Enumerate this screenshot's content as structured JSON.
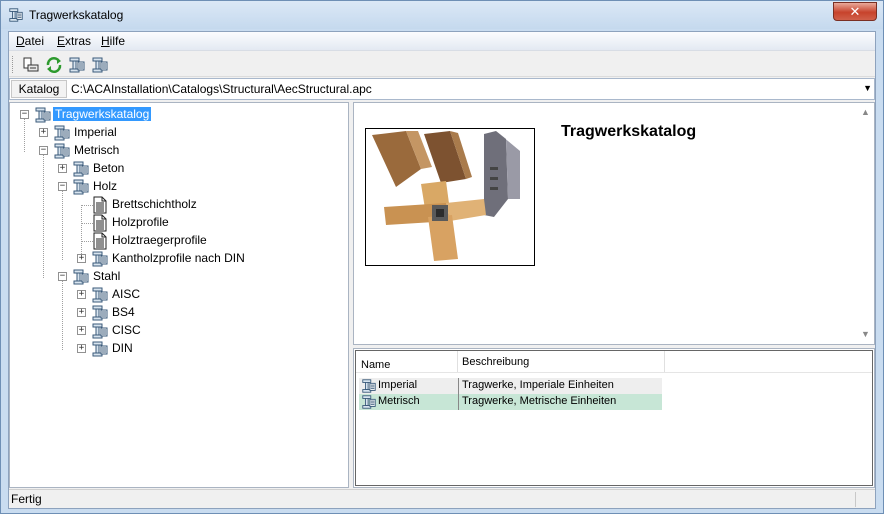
{
  "window": {
    "title": "Tragwerkskatalog",
    "close_label": "✕"
  },
  "menu": [
    {
      "key": "D",
      "rest": "atei"
    },
    {
      "key": "E",
      "rest": "xtras"
    },
    {
      "key": "H",
      "rest": "ilfe"
    }
  ],
  "katalog": {
    "label": "Katalog",
    "path": "C:\\ACAInstallation\\Catalogs\\Structural\\AecStructural.apc"
  },
  "tree": {
    "root": "Tragwerkskatalog",
    "imperial": "Imperial",
    "metrisch": "Metrisch",
    "beton": "Beton",
    "holz": "Holz",
    "brettschichtholz": "Brettschichtholz",
    "holzprofile": "Holzprofile",
    "holztraegerprofile": "Holztraegerprofile",
    "kantholzprofile": "Kantholzprofile nach DIN",
    "stahl": "Stahl",
    "aisc": "AISC",
    "bs4": "BS4",
    "cisc": "CISC",
    "din": "DIN"
  },
  "preview": {
    "title": "Tragwerkskatalog"
  },
  "list": {
    "headers": {
      "name": "Name",
      "beschreibung": "Beschreibung"
    },
    "rows": [
      {
        "name": "Imperial",
        "desc": "Tragwerke, Imperiale Einheiten"
      },
      {
        "name": "Metrisch",
        "desc": "Tragwerke, Metrische Einheiten"
      }
    ]
  },
  "status": {
    "text": "Fertig"
  },
  "colors": {
    "selection": "#3399ff",
    "list_selected": "#c7e6d6",
    "title_bar": "#c9dcf0"
  }
}
